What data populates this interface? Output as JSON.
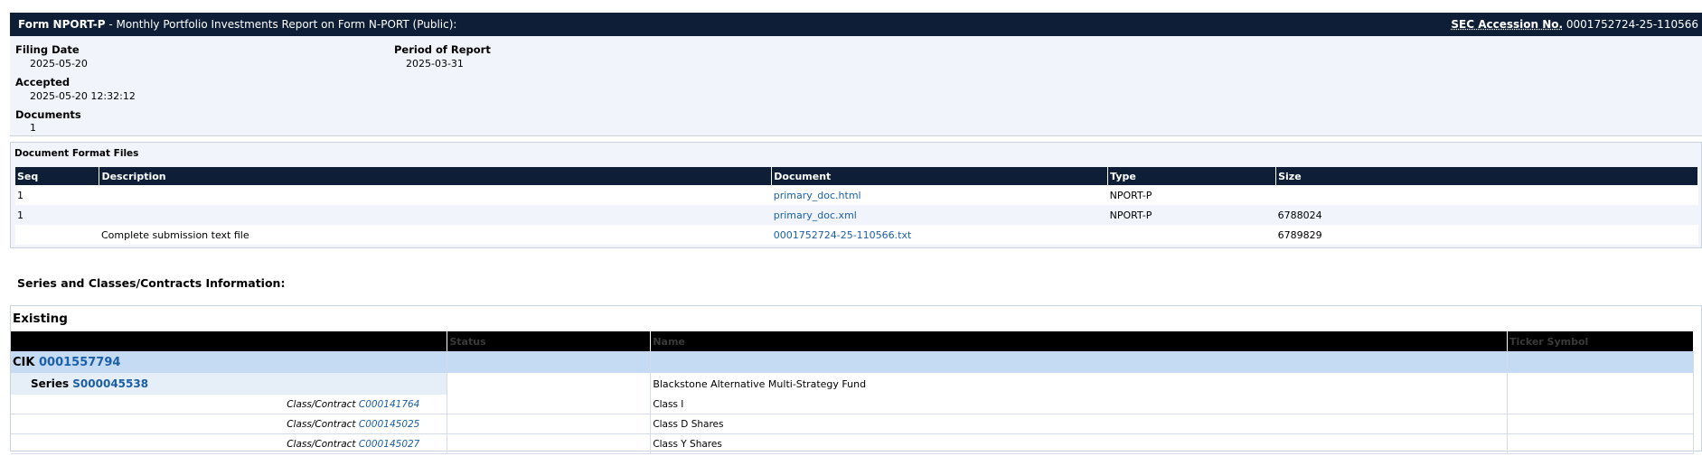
{
  "header": {
    "form_name": "Form NPORT-P",
    "form_desc": " - Monthly Portfolio Investments Report on Form N-PORT (Public):",
    "accession_label": "SEC Accession No.",
    "accession_number": "0001752724-25-110566"
  },
  "info": {
    "filing_date_label": "Filing Date",
    "filing_date": "2025-05-20",
    "accepted_label": "Accepted",
    "accepted": "2025-05-20 12:32:12",
    "documents_label": "Documents",
    "documents": "1",
    "period_label": "Period of Report",
    "period": "2025-03-31"
  },
  "doc_files": {
    "title": "Document Format Files",
    "columns": [
      "Seq",
      "Description",
      "Document",
      "Type",
      "Size"
    ],
    "rows": [
      {
        "seq": "1",
        "description": "",
        "document": "primary_doc.html",
        "type": "NPORT-P",
        "size": ""
      },
      {
        "seq": "1",
        "description": "",
        "document": "primary_doc.xml",
        "type": "NPORT-P",
        "size": "6788024"
      },
      {
        "seq": "",
        "description": "Complete submission text file",
        "document": "0001752724-25-110566.txt",
        "type": "",
        "size": "6789829"
      }
    ]
  },
  "series_info": {
    "heading": "Series and Classes/Contracts Information:",
    "existing_title": "Existing",
    "columns": [
      "",
      "Status",
      "Name",
      "Ticker Symbol"
    ],
    "cik_label": "CIK",
    "cik": "0001557794",
    "series_label": "Series",
    "series_id": "S000045538",
    "series_name": "Blackstone Alternative Multi-Strategy Fund",
    "class_label": "Class/Contract",
    "classes": [
      {
        "id": "C000141764",
        "name": "Class I"
      },
      {
        "id": "C000145025",
        "name": "Class D Shares"
      },
      {
        "id": "C000145027",
        "name": "Class Y Shares"
      }
    ]
  }
}
